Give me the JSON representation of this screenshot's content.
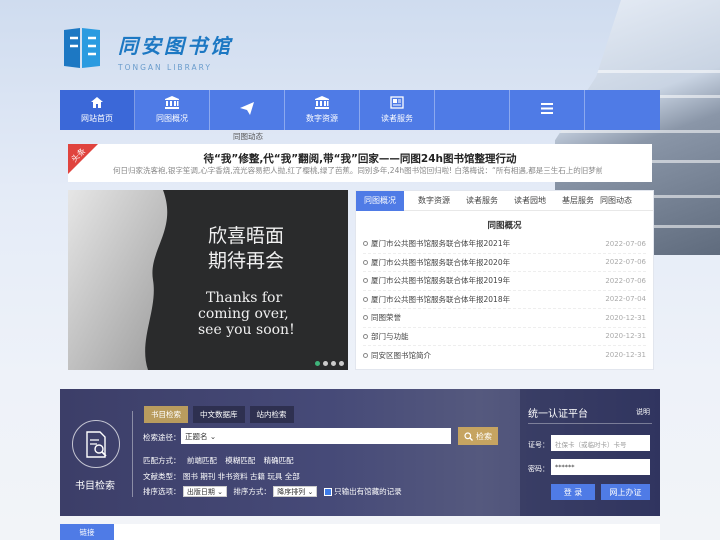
{
  "logo": {
    "cn": "同安图书馆",
    "en": "TONGAN LIBRARY"
  },
  "nav": [
    {
      "label": "网站首页",
      "icon": "home-icon"
    },
    {
      "label": "同图概况",
      "icon": "bank-icon"
    },
    {
      "label": "",
      "icon": "paper-plane-icon"
    },
    {
      "label": "数字资源",
      "icon": "bank-icon"
    },
    {
      "label": "读者服务",
      "icon": "newspaper-icon"
    },
    {
      "label": "",
      "icon": ""
    },
    {
      "label": "",
      "icon": "menu-icon"
    },
    {
      "label": "",
      "icon": ""
    }
  ],
  "subnav": "同图动态",
  "headline": {
    "badge": "头条",
    "title": "待“我”修整,代“我”翻阅,带“我”回家——同图24h图书馆整理行动",
    "desc": "何日归家洗客袍,银字笙调,心字香烧,流光容易把人抛,红了樱桃,绿了芭蕉。同别多年,24h图书馆回归啦! 白落梅说：“所有相遇,都是三生石上的旧梦前缘,久别重..."
  },
  "slider": {
    "line1": "欣喜晤面",
    "line2": "期待再会",
    "en1": "Thanks for",
    "en2": "coming over,",
    "en3": "see you soon!",
    "dots": 4,
    "active_dot": 0
  },
  "news": {
    "tabs": [
      "同图概况",
      "数字资源",
      "读者服务",
      "读者园地",
      "基层服务",
      "同图动态"
    ],
    "section": "同图概况",
    "items": [
      {
        "title": "厦门市公共图书馆服务联合体年报2021年",
        "date": "2022-07-06"
      },
      {
        "title": "厦门市公共图书馆服务联合体年报2020年",
        "date": "2022-07-06"
      },
      {
        "title": "厦门市公共图书馆服务联合体年报2019年",
        "date": "2022-07-06"
      },
      {
        "title": "厦门市公共图书馆服务联合体年报2018年",
        "date": "2022-07-04"
      },
      {
        "title": "同图荣誉",
        "date": "2020-12-31"
      },
      {
        "title": "部门与功能",
        "date": "2020-12-31"
      },
      {
        "title": "同安区图书馆简介",
        "date": "2020-12-31"
      }
    ]
  },
  "search": {
    "module_label": "书目检索",
    "tabs": [
      "书目检索",
      "中文数据库",
      "站内检索"
    ],
    "path_label": "检索途径：",
    "path_value": "正题名",
    "button": "检索",
    "match_label": "匹配方式：",
    "match_opts": [
      "前端匹配",
      "模糊匹配",
      "精确匹配"
    ],
    "doc_label": "文献类型：",
    "doc_opts": "图书 期刊 非书资料 古籍 玩具 全部",
    "sort_label": "排序选项：",
    "sort_value": "出版日期",
    "sort_way_label": "排序方式：",
    "sort_way_value": "降序排列",
    "only_label": "只输出有馆藏的记录"
  },
  "auth": {
    "title": "统一认证平台",
    "help": "说明",
    "id_label": "证号：",
    "id_placeholder": "社保卡（或临时卡）卡号",
    "pw_label": "密码：",
    "pw_value": "******",
    "login": "登 录",
    "online": "网上办证"
  },
  "links": {
    "title": "链接"
  },
  "colors": {
    "primary": "#4f7be6",
    "gold": "#c6a461",
    "badge": "#e0433e"
  }
}
